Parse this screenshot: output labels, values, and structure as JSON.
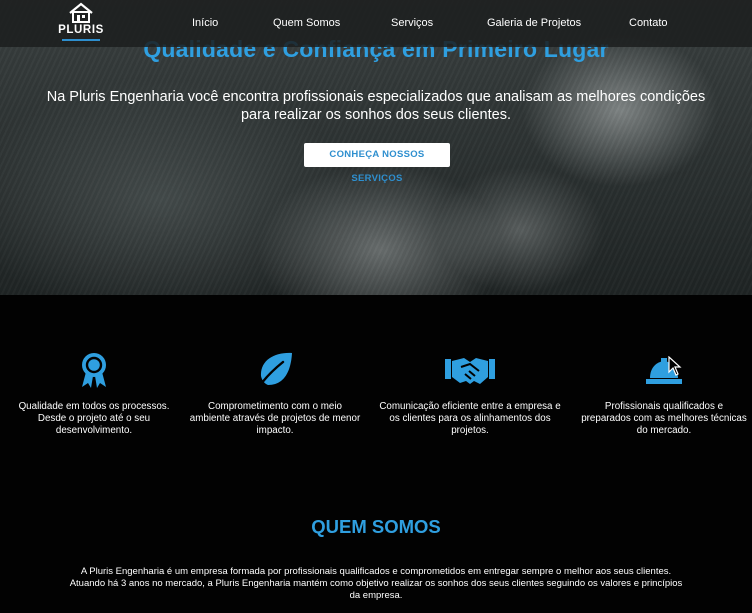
{
  "nav": {
    "logo_text": "PLURIS",
    "items": [
      "Início",
      "Quem Somos",
      "Serviços",
      "Galeria de Projetos",
      "Contato"
    ]
  },
  "hero": {
    "title": "Qualidade e Confiança em Primeiro Lugar",
    "text_line1": "Na Pluris Engenharia você encontra profissionais especializados que analisam as melhores condições",
    "text_line2": "para realizar os sonhos dos seus clientes.",
    "button_label": "CONHEÇA NOSSOS SERVIÇOS"
  },
  "features": [
    {
      "icon": "award-ribbon-icon",
      "line1": "Qualidade em todos os processos.",
      "line2": "Desde o projeto até o seu",
      "line3": "desenvolvimento."
    },
    {
      "icon": "leaf-icon",
      "line1": "Comprometimento com o meio",
      "line2": "ambiente através de projetos de menor",
      "line3": "impacto."
    },
    {
      "icon": "handshake-icon",
      "line1": "Comunicação eficiente entre a empresa e",
      "line2": "os clientes para os alinhamentos dos",
      "line3": "projetos."
    },
    {
      "icon": "hard-hat-icon",
      "line1": "Profissionais qualificados e",
      "line2": "preparados com as melhores técnicas",
      "line3": "do mercado."
    }
  ],
  "about": {
    "title": "QUEM SOMOS",
    "line1": "A Pluris Engenharia é um empresa formada por profissionais qualificados e comprometidos em entregar sempre o melhor aos seus clientes.",
    "line2": "Atuando há 3 anos no mercado, a Pluris Engenharia mantém como objetivo realizar os sonhos dos seus clientes seguindo os valores e princípios",
    "line3": "da empresa."
  },
  "colors": {
    "accent": "#2f9fe0",
    "nav_bg": "#1c1e1e",
    "page_bg": "#020202"
  }
}
